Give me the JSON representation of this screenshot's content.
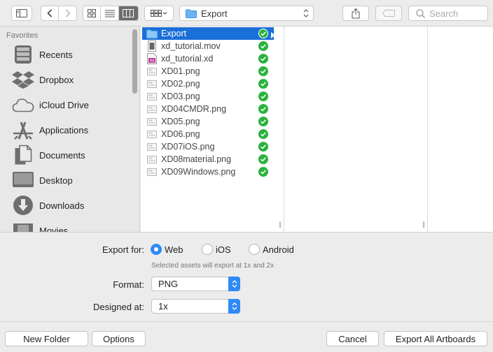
{
  "toolbar": {
    "path_label": "Export",
    "search_placeholder": "Search",
    "view_modes": [
      "icon-view-icon",
      "list-view-icon",
      "column-view-icon"
    ],
    "active_view": "column-view-icon"
  },
  "sidebar": {
    "heading": "Favorites",
    "items": [
      {
        "label": "Recents",
        "icon": "clock-icon"
      },
      {
        "label": "Dropbox",
        "icon": "dropbox-icon"
      },
      {
        "label": "iCloud Drive",
        "icon": "cloud-icon"
      },
      {
        "label": "Applications",
        "icon": "applications-icon"
      },
      {
        "label": "Documents",
        "icon": "document-icon"
      },
      {
        "label": "Desktop",
        "icon": "desktop-icon"
      },
      {
        "label": "Downloads",
        "icon": "download-icon"
      },
      {
        "label": "Movies",
        "icon": "film-icon"
      }
    ]
  },
  "files": [
    {
      "name": "Export",
      "type": "folder",
      "selected": true
    },
    {
      "name": "xd_tutorial.mov",
      "type": "movie"
    },
    {
      "name": "xd_tutorial.xd",
      "type": "xd"
    },
    {
      "name": "XD01.png",
      "type": "png"
    },
    {
      "name": "XD02.png",
      "type": "png"
    },
    {
      "name": "XD03.png",
      "type": "png"
    },
    {
      "name": "XD04CMDR.png",
      "type": "png"
    },
    {
      "name": "XD05.png",
      "type": "png"
    },
    {
      "name": "XD06.png",
      "type": "png"
    },
    {
      "name": "XD07iOS.png",
      "type": "png"
    },
    {
      "name": "XD08material.png",
      "type": "png"
    },
    {
      "name": "XD09Windows.png",
      "type": "png"
    }
  ],
  "export_options": {
    "export_for_label": "Export for:",
    "options": [
      {
        "label": "Web",
        "selected": true
      },
      {
        "label": "iOS",
        "selected": false
      },
      {
        "label": "Android",
        "selected": false
      }
    ],
    "hint": "Selected assets will export at 1x and 2x",
    "format_label": "Format:",
    "format_value": "PNG",
    "designed_at_label": "Designed at:",
    "designed_at_value": "1x"
  },
  "footer": {
    "new_folder": "New Folder",
    "options": "Options",
    "cancel": "Cancel",
    "export_all": "Export All Artboards"
  },
  "colors": {
    "selection": "#1a6fd8",
    "accent": "#2f8af5",
    "sync_green": "#28b43c"
  }
}
